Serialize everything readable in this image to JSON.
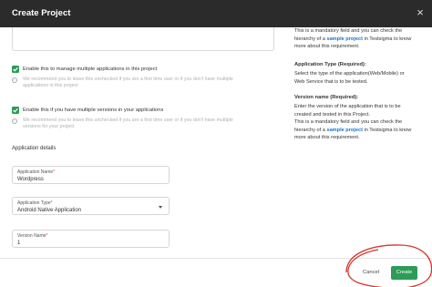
{
  "dialog": {
    "title": "Create Project",
    "close_glyph": "×"
  },
  "form": {
    "multi_apps": {
      "label": "Enable this to manage multiple applications in this project",
      "hint_line1": "We recommend you to leave this unchecked if you are a first time user or if you don't have multiple",
      "hint_line2": "applications in this project",
      "checked": true
    },
    "multi_versions": {
      "label": "Enable this if you have multiple versions in your applications",
      "hint_line1": "We recommend you to leave this unchecked if you are a first time user or if you don't have multiple",
      "hint_line2": "versions for your project",
      "checked": true
    },
    "section_title": "Application details",
    "application_name": {
      "label": "Application Name",
      "required": "*",
      "value": "Wordpress"
    },
    "application_type": {
      "label": "Application Type",
      "required": "*",
      "value": "Android Native Application"
    },
    "version_name": {
      "label": "Version Name",
      "required": "*",
      "value": "1"
    }
  },
  "help": {
    "p1_line1": "This is a mandatory field and you can check the",
    "p1_pre": "hierarchy of a ",
    "p1_link": "sample project",
    "p1_post": " in Testsigma to know",
    "p1_line3": "more about this requirement.",
    "type_heading": "Application Type (Required):",
    "type_line1": "Select the type of the application(Web/Mobile) or",
    "type_line2": "Web Service that is to be tested.",
    "version_heading": "Version name (Required):",
    "version_line1": "Enter the version of the application that is to be",
    "version_line2": "created and tested in this Project.",
    "version_line3": "This is a mandatory field and you can check the",
    "version_pre": "hierarchy of a ",
    "version_link": "sample project",
    "version_post": " in Testsigma to know",
    "version_line5": "more about this requirement."
  },
  "footer": {
    "cancel_label": "Cancel",
    "create_label": "Create"
  },
  "colors": {
    "accent": "#2e9b57",
    "header": "#2b2b2b",
    "link": "#1a73c8",
    "annotation": "#d9342b"
  }
}
